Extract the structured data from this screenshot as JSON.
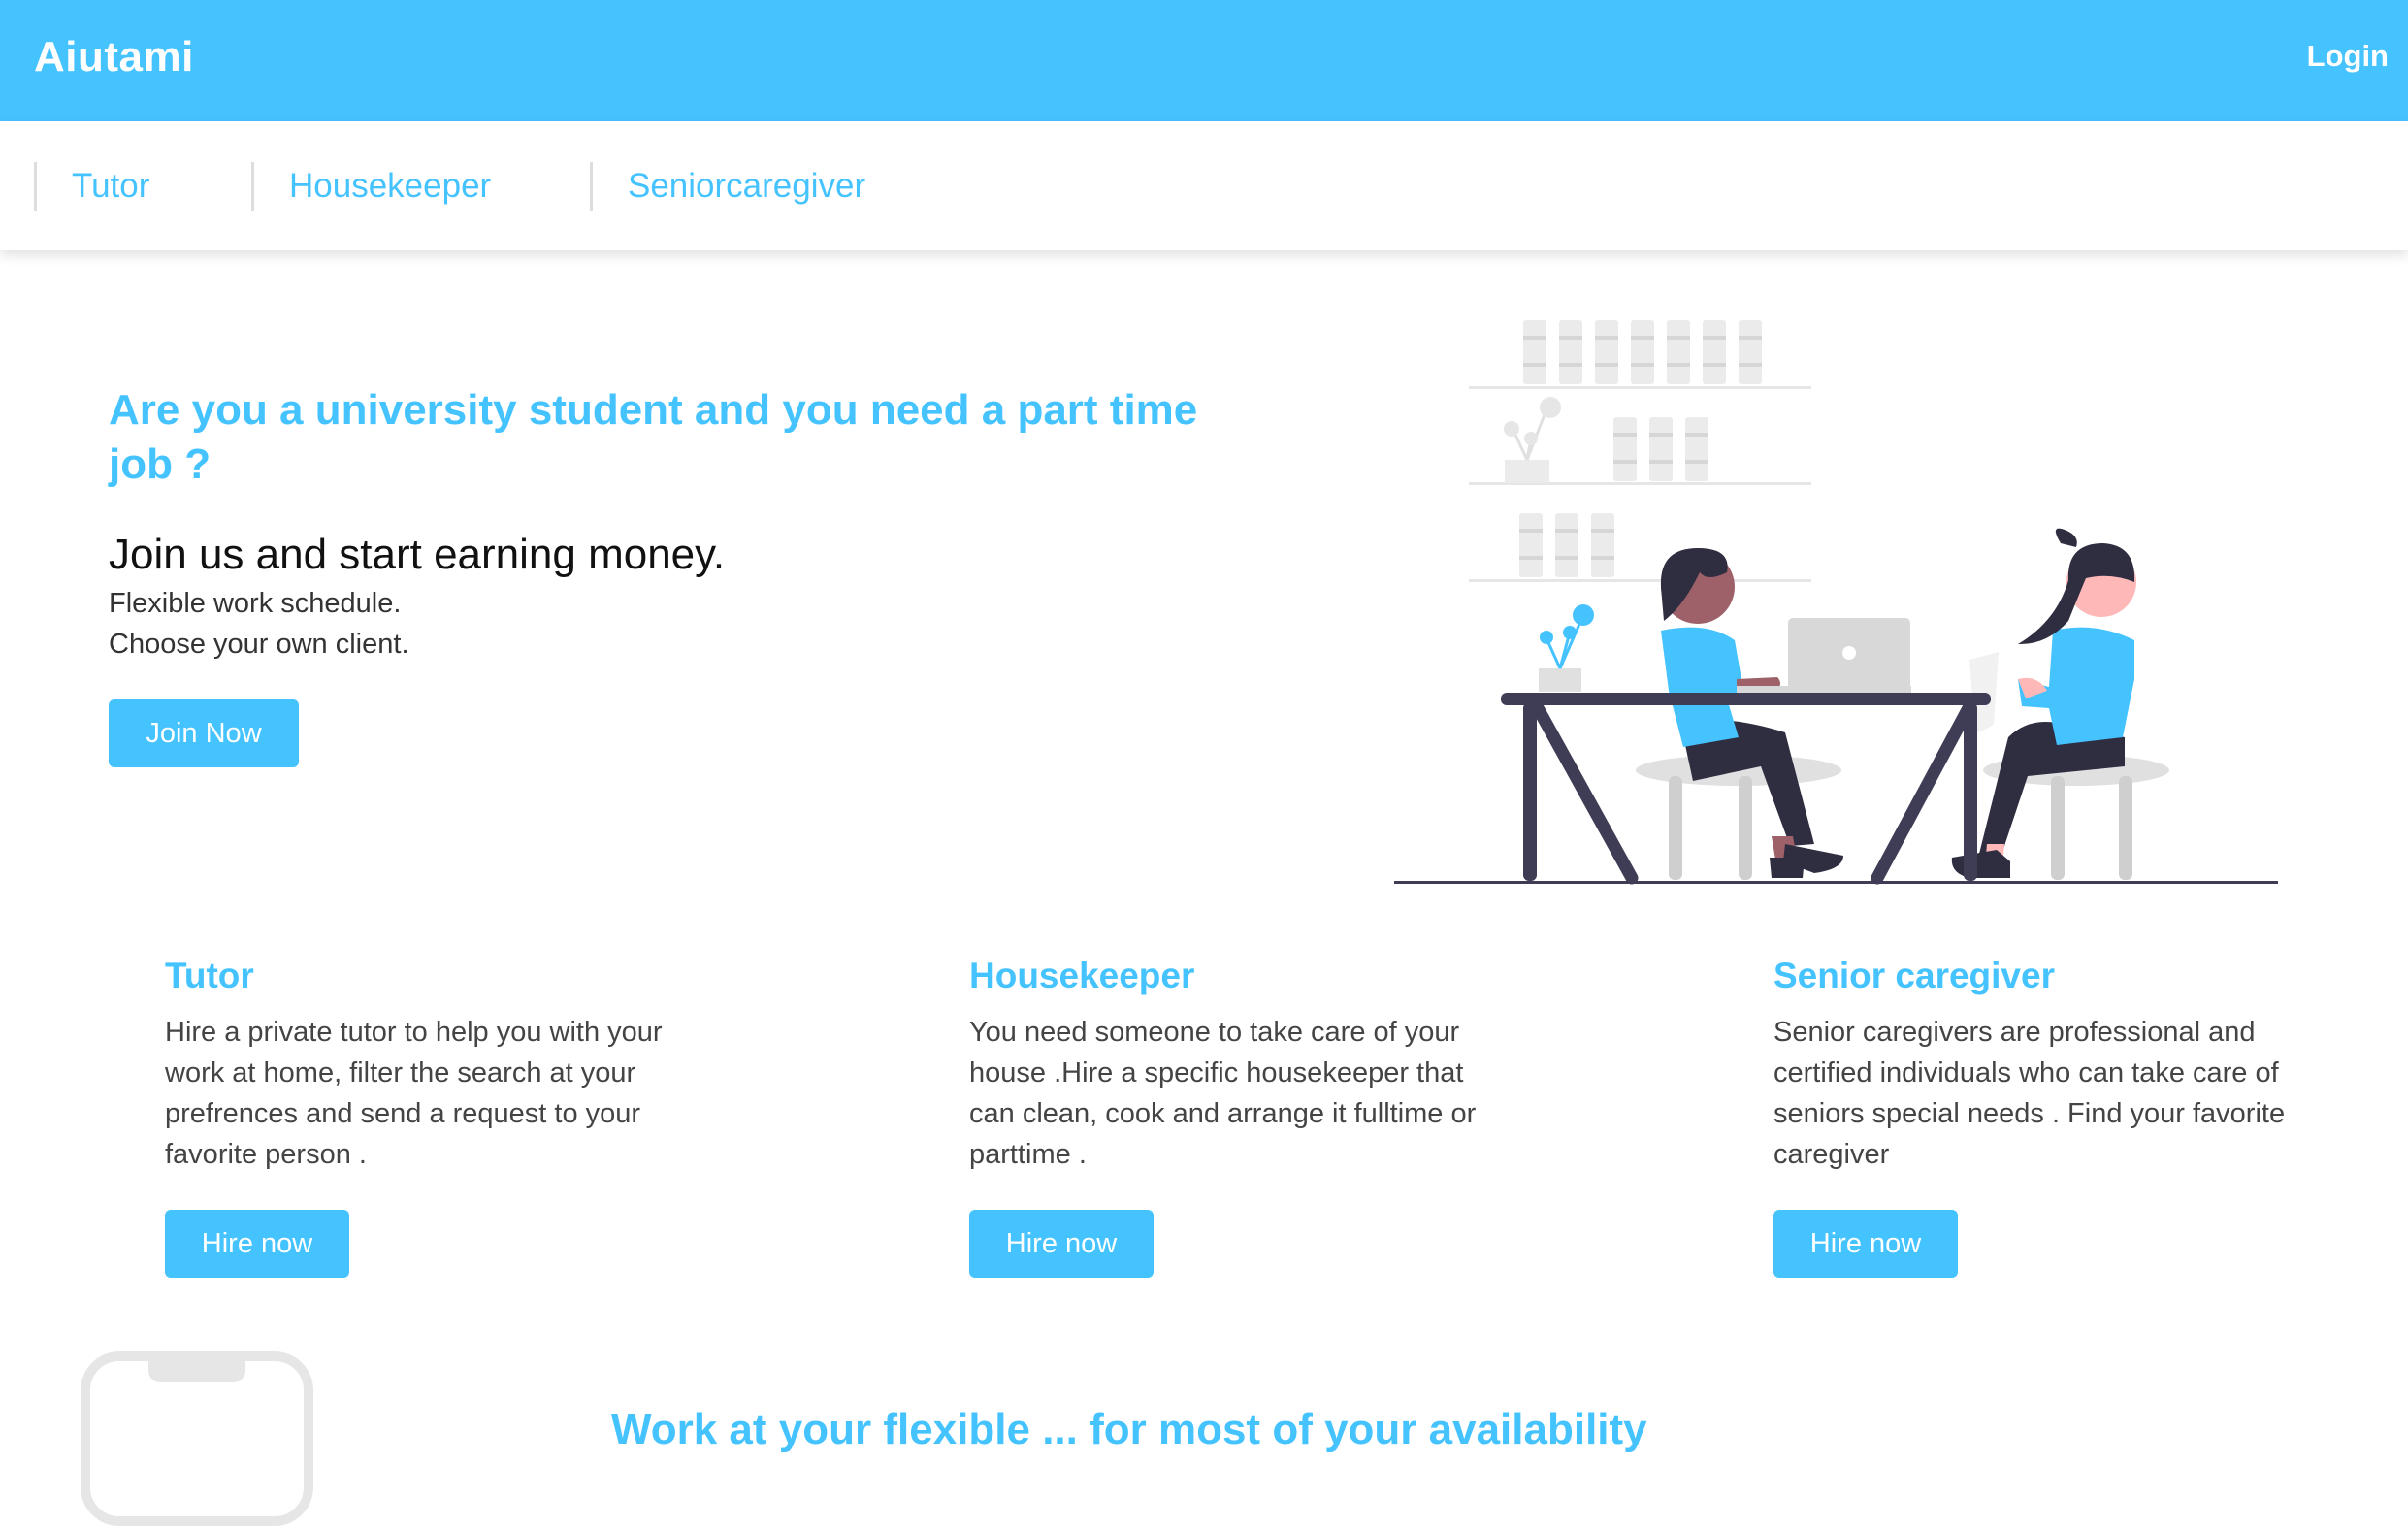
{
  "header": {
    "brand": "Aiutami",
    "login_label": "Login"
  },
  "subnav": {
    "items": [
      {
        "label": "Tutor"
      },
      {
        "label": "Housekeeper"
      },
      {
        "label": "Seniorcaregiver"
      }
    ]
  },
  "hero": {
    "question": "Are you a university student and you need a part time job ?",
    "headline": "Join us and start earning money.",
    "line1": "Flexible work schedule.",
    "line2": "Choose your own client.",
    "join_label": "Join Now"
  },
  "services": [
    {
      "title": "Tutor",
      "description": "Hire a private tutor to help you with your work at home, filter the search at your prefrences and send a request to your favorite person .",
      "button": "Hire now"
    },
    {
      "title": "Housekeeper",
      "description": "You need someone to take care of your house .Hire a specific housekeeper that can clean, cook and arrange it fulltime or parttime .",
      "button": "Hire now"
    },
    {
      "title": "Senior caregiver",
      "description": "Senior caregivers are professional and certified individuals who can take care of seniors special needs . Find your favorite caregiver",
      "button": "Hire now"
    }
  ],
  "bottom": {
    "heading": "Work at your flexible ... for most of your availability"
  },
  "colors": {
    "accent": "#45c3ff",
    "dark": "#2f2e41",
    "skin_dark": "#9e616a",
    "skin_light": "#ffb8b8",
    "shelf": "#e6e6e6"
  },
  "icons": {
    "illustration": "two-people-at-table-illustration",
    "phone": "phone-outline-icon"
  }
}
